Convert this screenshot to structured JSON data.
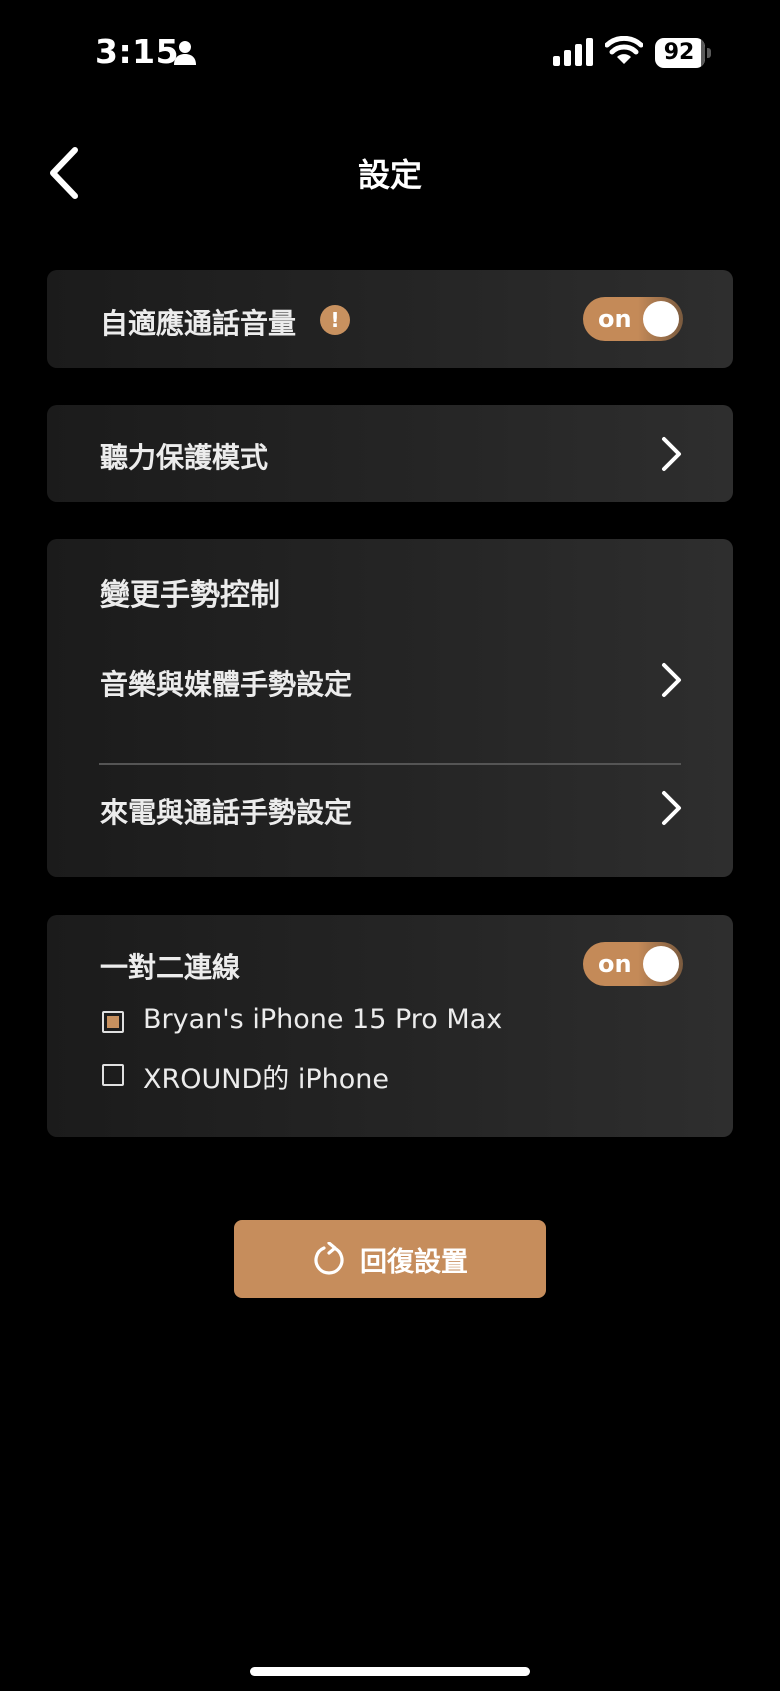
{
  "status_bar": {
    "time": "3:15",
    "battery_level": "92",
    "icons": [
      "person-icon",
      "signal-icon",
      "wifi-icon",
      "battery-icon"
    ]
  },
  "header": {
    "title": "設定",
    "back_icon": "chevron-left-icon"
  },
  "adaptive_volume": {
    "label": "自適應通話音量",
    "warning_glyph": "!",
    "toggle_label": "on",
    "toggle_state": true
  },
  "hearing_protection": {
    "label": "聽力保護模式"
  },
  "gesture_control": {
    "title": "變更手勢控制",
    "items": [
      {
        "label": "音樂與媒體手勢設定"
      },
      {
        "label": "來電與通話手勢設定"
      }
    ]
  },
  "multipoint": {
    "label": "一對二連線",
    "toggle_label": "on",
    "toggle_state": true,
    "devices": [
      {
        "label": "Bryan's iPhone 15 Pro Max",
        "checked": true
      },
      {
        "label": "XROUND的 iPhone",
        "checked": false
      }
    ]
  },
  "reset": {
    "label": "回復設置",
    "icon": "refresh-icon"
  },
  "colors": {
    "accent": "#c68d5c",
    "background": "#000000",
    "card": "#242424"
  }
}
